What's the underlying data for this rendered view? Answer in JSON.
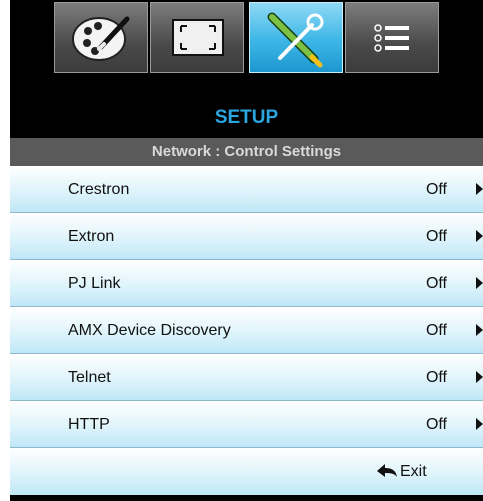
{
  "tabs": [
    {
      "icon": "palette-icon",
      "active": false
    },
    {
      "icon": "display-icon",
      "active": false
    },
    {
      "icon": "setup-tools-icon",
      "active": true
    },
    {
      "icon": "options-list-icon",
      "active": false
    }
  ],
  "menu": {
    "title": "SETUP",
    "subtitle": "Network : Control Settings"
  },
  "items": [
    {
      "label": "Crestron",
      "value": "Off"
    },
    {
      "label": "Extron",
      "value": "Off"
    },
    {
      "label": "PJ Link",
      "value": "Off"
    },
    {
      "label": "AMX Device Discovery",
      "value": "Off"
    },
    {
      "label": "Telnet",
      "value": "Off"
    },
    {
      "label": "HTTP",
      "value": "Off"
    }
  ],
  "exit": {
    "label": "Exit",
    "icon": "back-arrow-icon"
  },
  "colors": {
    "accent": "#2aa6e0",
    "active_tab": "#3cb6e6",
    "header_bar": "#5a5a5a"
  }
}
